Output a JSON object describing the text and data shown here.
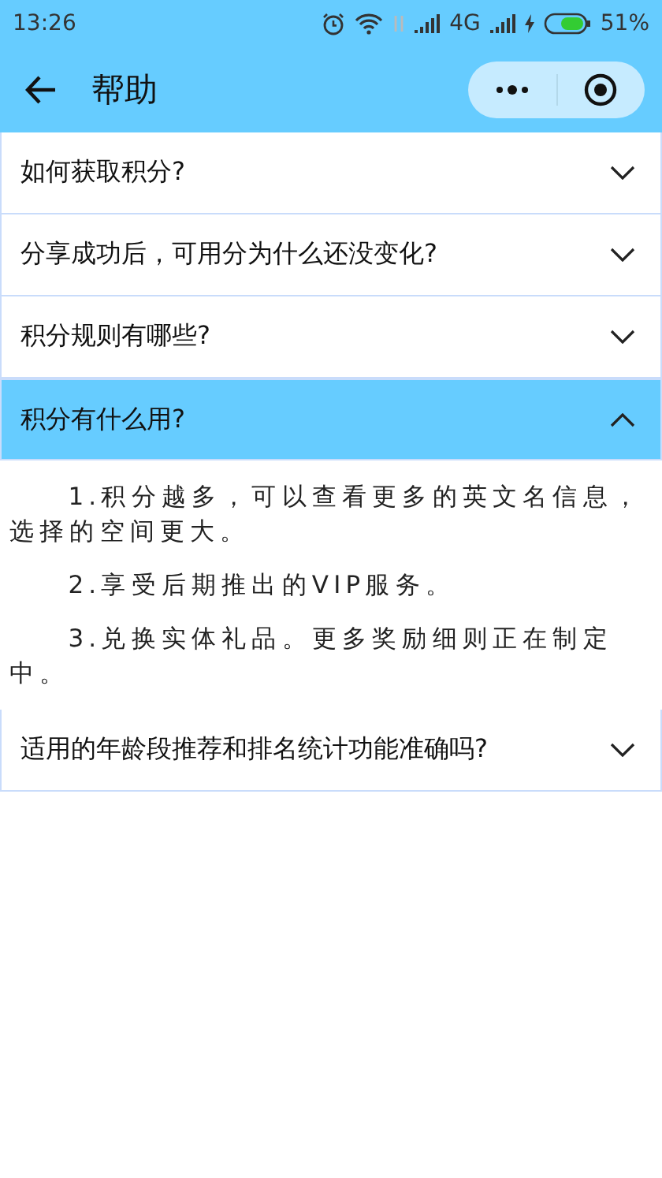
{
  "status_bar": {
    "time": "13:26",
    "network": "4G",
    "battery": "51%"
  },
  "header": {
    "title": "帮助"
  },
  "faq": [
    {
      "question": "如何获取积分?",
      "expanded": false
    },
    {
      "question": "分享成功后，可用分为什么还没变化?",
      "expanded": false
    },
    {
      "question": "积分规则有哪些?",
      "expanded": false
    },
    {
      "question": "积分有什么用?",
      "expanded": true,
      "answer": [
        "1.积分越多，可以查看更多的英文名信息，选择的空间更大。",
        "2.享受后期推出的VIP服务。",
        "3.兑换实体礼品。更多奖励细则正在制定中。"
      ]
    },
    {
      "question": "适用的年龄段推荐和排名统计功能准确吗?",
      "expanded": false
    }
  ]
}
